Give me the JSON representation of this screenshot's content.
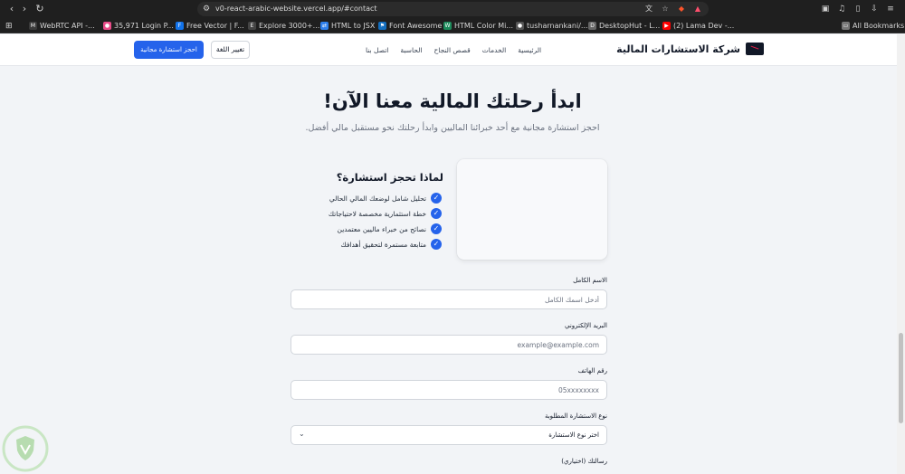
{
  "browser": {
    "url": "v0-react-arabic-website.vercel.app/#contact",
    "bookmarks": [
      {
        "label": "WebRTC API -...",
        "icon": "webrtc-favicon"
      },
      {
        "label": "35,971 Login P...",
        "icon": "dribbble-favicon"
      },
      {
        "label": "Free Vector | F...",
        "icon": "freepik-favicon"
      },
      {
        "label": "Explore 3000+...",
        "icon": "explore-favicon"
      },
      {
        "label": "HTML to JSX",
        "icon": "transform-favicon"
      },
      {
        "label": "Font Awesome",
        "icon": "fontawesome-favicon"
      },
      {
        "label": "HTML Color Mi...",
        "icon": "colormix-favicon"
      },
      {
        "label": "tusharnankani/...",
        "icon": "github-favicon"
      },
      {
        "label": "DesktopHut - L...",
        "icon": "desktophut-favicon"
      },
      {
        "label": "(2) Lama Dev -...",
        "icon": "youtube-favicon"
      }
    ],
    "all_bookmarks": "All Bookmarks"
  },
  "header": {
    "brand": "شركة الاستشارات المالية",
    "nav": [
      "الرئيسية",
      "الخدمات",
      "قصص النجاح",
      "الحاسبة",
      "اتصل بنا"
    ],
    "lang_button": "تغيير اللغة",
    "cta_button": "احجز استشارة مجانية"
  },
  "hero": {
    "title": "ابدأ رحلتك المالية معنا الآن!",
    "subtitle": "احجز استشارة مجانية مع أحد خبرائنا الماليين وابدأ رحلتك نحو مستقبل مالي أفضل."
  },
  "why": {
    "title": "لماذا تحجز استشارة؟",
    "items": [
      "تحليل شامل لوضعك المالي الحالي",
      "خطة استثمارية مخصصة لاحتياجاتك",
      "نصائح من خبراء ماليين معتمدين",
      "متابعة مستمرة لتحقيق أهدافك"
    ]
  },
  "form": {
    "name_label": "الاسم الكامل",
    "name_placeholder": "أدخل اسمك الكامل",
    "email_label": "البريد الإلكتروني",
    "email_placeholder": "example@example.com",
    "phone_label": "رقم الهاتف",
    "phone_placeholder": "05xxxxxxxx",
    "type_label": "نوع الاستشارة المطلوبة",
    "type_value": "اختر نوع الاستشارة",
    "message_label": "رسالتك (اختياري)"
  },
  "colors": {
    "primary": "#2563eb",
    "background": "#f2f4f7",
    "header_bg": "#ffffff"
  }
}
